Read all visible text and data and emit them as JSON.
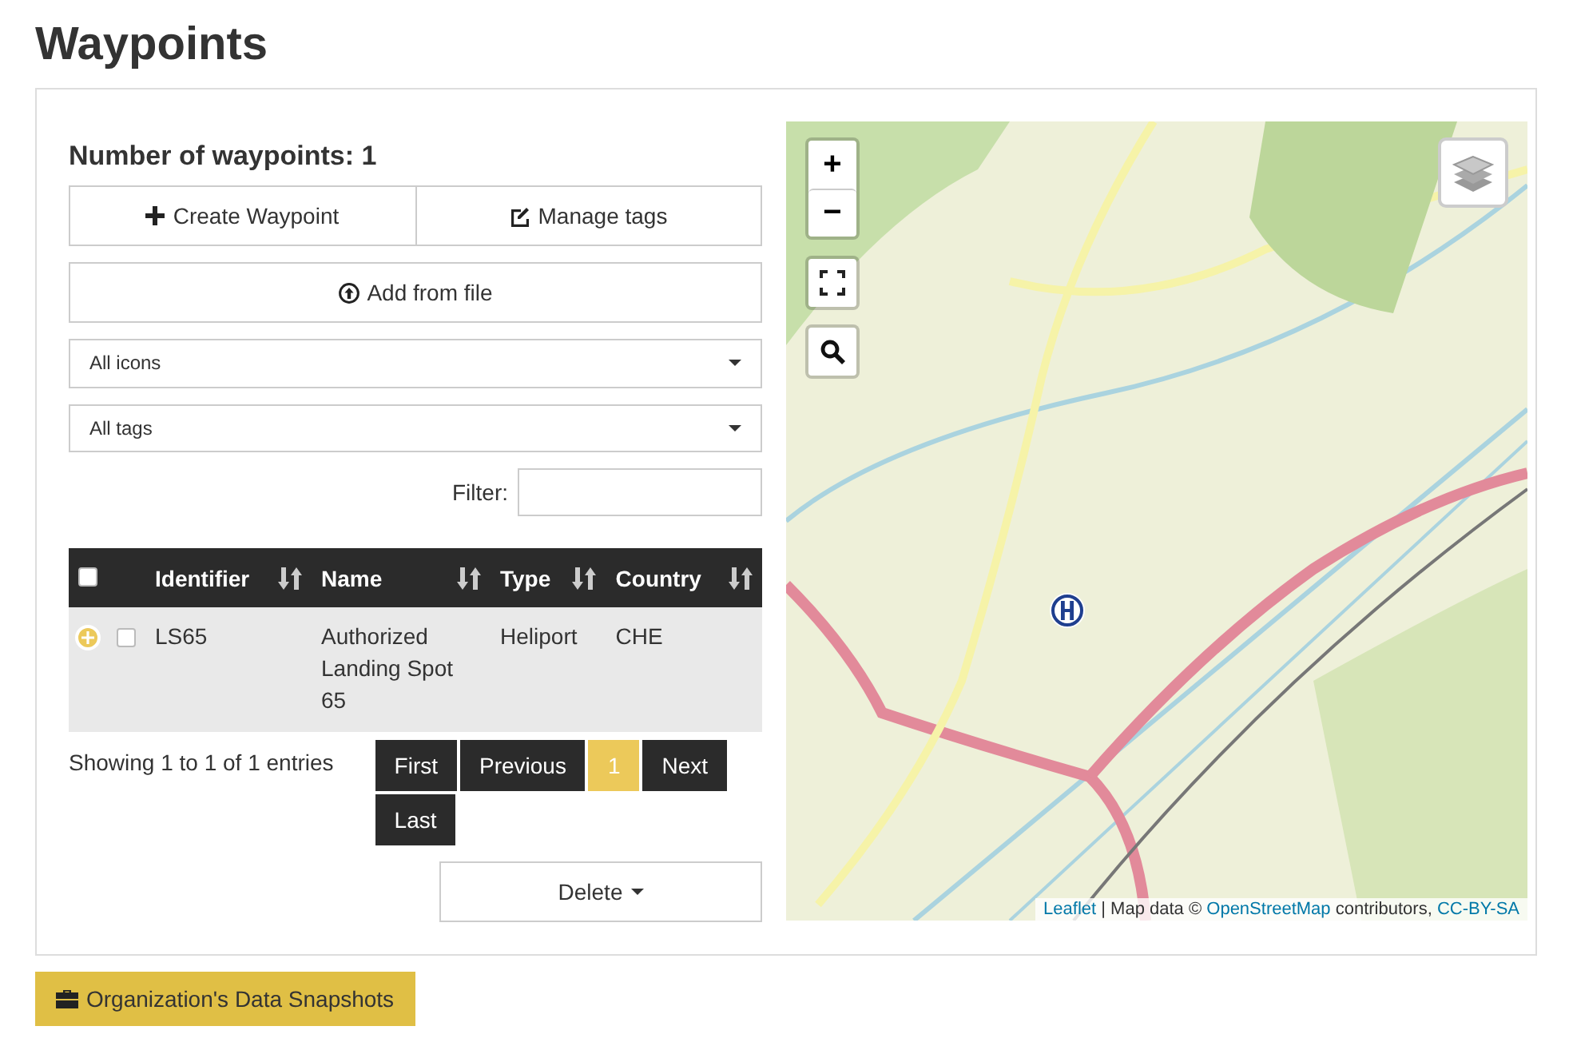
{
  "page_title": "Waypoints",
  "count_heading": "Number of waypoints: 1",
  "actions": [
    {
      "label": "Create Waypoint"
    },
    {
      "label": "Manage tags"
    },
    {
      "label": "Add from file"
    }
  ],
  "selects": [
    {
      "value": "All icons"
    },
    {
      "value": "All tags"
    }
  ],
  "filter": {
    "label": "Filter:"
  },
  "table": {
    "select_all_checked": false,
    "columns": [
      {
        "label": "Identifier"
      },
      {
        "label": "Name"
      },
      {
        "label": "Type"
      },
      {
        "label": "Country"
      }
    ],
    "rows": [
      {
        "expanded": false,
        "checked": false,
        "cells": [
          "LS65",
          "Authorized Landing Spot 65",
          "Heliport",
          "CHE"
        ]
      }
    ]
  },
  "info": "Showing 1 to 1 of 1 entries",
  "pagination": [
    {
      "label": "First",
      "selected": false
    },
    {
      "label": "Previous",
      "selected": false
    },
    {
      "label": "1",
      "selected": true
    },
    {
      "label": "Next",
      "selected": false
    },
    {
      "label": "Last",
      "selected": false
    }
  ],
  "delete_button": {
    "label": "Delete"
  },
  "map": {
    "zoom_in": "+",
    "zoom_out": "−",
    "attribution": [
      {
        "text": "Leaflet",
        "kind": "link"
      },
      {
        "text": " | Map data © ",
        "kind": "text"
      },
      {
        "text": "OpenStreetMap",
        "kind": "link"
      },
      {
        "text": " contributors, ",
        "kind": "text"
      },
      {
        "text": "CC-BY-SA",
        "kind": "link"
      }
    ]
  },
  "snapshots_button": {
    "label": "Organization's Data Snapshots"
  }
}
